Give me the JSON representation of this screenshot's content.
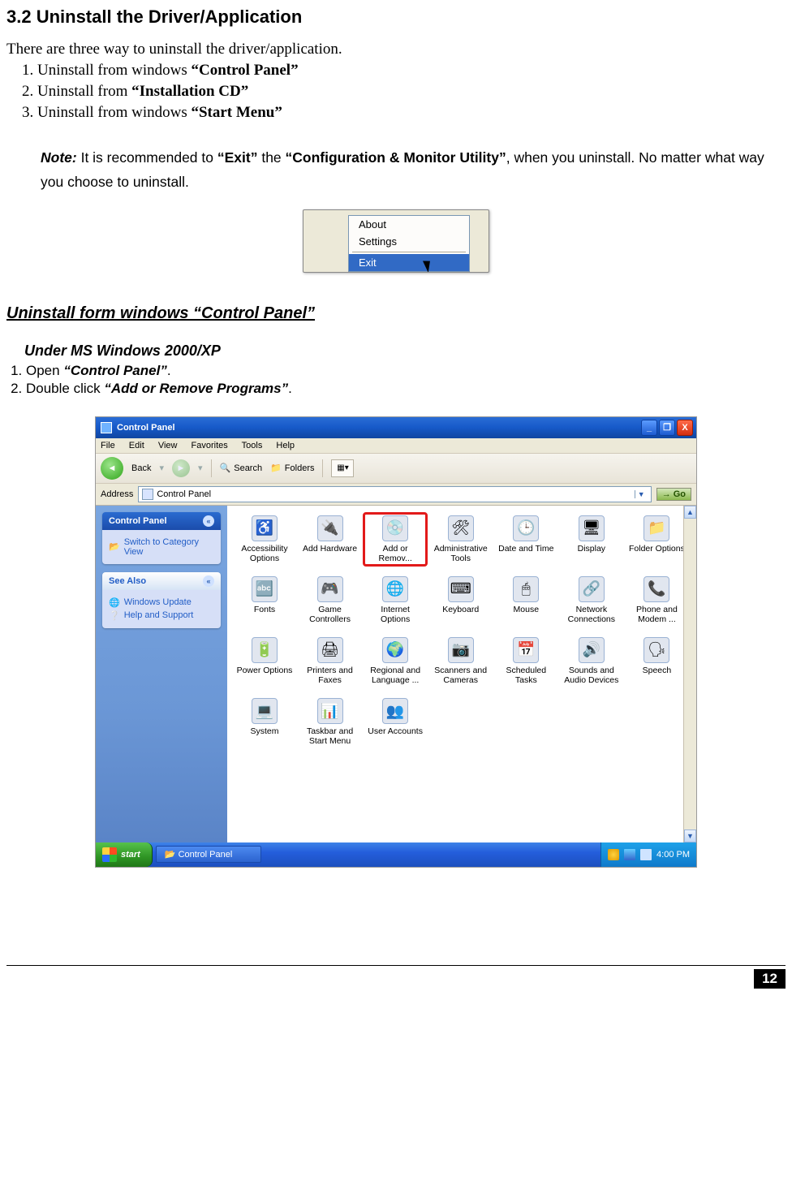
{
  "heading": "3.2  Uninstall the Driver/Application",
  "intro": "There are three way to uninstall the driver/application.",
  "list": [
    {
      "pre": "Uninstall from windows ",
      "bold": "“Control Panel”"
    },
    {
      "pre": "Uninstall from ",
      "bold": "“Installation CD”"
    },
    {
      "pre": "Uninstall from windows ",
      "bold": "“Start Menu”"
    }
  ],
  "note": {
    "label": "Note:",
    "p1a": " It is recommended to ",
    "q1": "“Exit”",
    "p1b": " the ",
    "q2": "“Configuration & Monitor Utility”",
    "p1c": ", when you uninstall. No matter what way you choose to uninstall."
  },
  "ctx_menu": {
    "items": [
      "About",
      "Settings",
      "Exit"
    ],
    "selected": "Exit"
  },
  "subheading": "Uninstall form windows “Control Panel”",
  "sub2": "Under MS Windows 2000/XP",
  "steps": [
    {
      "pre": "Open ",
      "quoted": "“Control Panel”",
      "post": "."
    },
    {
      "pre": "Double click ",
      "quoted": "“Add or Remove Programs”",
      "post": "."
    }
  ],
  "xp": {
    "title": "Control Panel",
    "menus": [
      "File",
      "Edit",
      "View",
      "Favorites",
      "Tools",
      "Help"
    ],
    "toolbar": {
      "back": "Back",
      "search": "Search",
      "folders": "Folders"
    },
    "address_label": "Address",
    "address_value": "Control Panel",
    "go": "Go",
    "side": {
      "panel1": {
        "title": "Control Panel",
        "link": "Switch to Category View"
      },
      "panel2": {
        "title": "See Also",
        "links": [
          "Windows Update",
          "Help and Support"
        ]
      }
    },
    "icons": [
      {
        "label": "Accessibility Options",
        "glyph": "♿"
      },
      {
        "label": "Add Hardware",
        "glyph": "🔌"
      },
      {
        "label": "Add or Remov...",
        "glyph": "💿",
        "hl": true
      },
      {
        "label": "Administrative Tools",
        "glyph": "🛠"
      },
      {
        "label": "Date and Time",
        "glyph": "🕒"
      },
      {
        "label": "Display",
        "glyph": "🖥"
      },
      {
        "label": "Folder Options",
        "glyph": "📁"
      },
      {
        "label": "Fonts",
        "glyph": "🔤"
      },
      {
        "label": "Game Controllers",
        "glyph": "🎮"
      },
      {
        "label": "Internet Options",
        "glyph": "🌐"
      },
      {
        "label": "Keyboard",
        "glyph": "⌨"
      },
      {
        "label": "Mouse",
        "glyph": "🖱"
      },
      {
        "label": "Network Connections",
        "glyph": "🔗"
      },
      {
        "label": "Phone and Modem ...",
        "glyph": "📞"
      },
      {
        "label": "Power Options",
        "glyph": "🔋"
      },
      {
        "label": "Printers and Faxes",
        "glyph": "🖨"
      },
      {
        "label": "Regional and Language ...",
        "glyph": "🌍"
      },
      {
        "label": "Scanners and Cameras",
        "glyph": "📷"
      },
      {
        "label": "Scheduled Tasks",
        "glyph": "📅"
      },
      {
        "label": "Sounds and Audio Devices",
        "glyph": "🔊"
      },
      {
        "label": "Speech",
        "glyph": "🗣"
      },
      {
        "label": "System",
        "glyph": "💻"
      },
      {
        "label": "Taskbar and Start Menu",
        "glyph": "📊"
      },
      {
        "label": "User Accounts",
        "glyph": "👥"
      }
    ],
    "taskbar": {
      "start": "start",
      "task": "Control Panel",
      "clock": "4:00 PM"
    }
  },
  "page_number": "12"
}
